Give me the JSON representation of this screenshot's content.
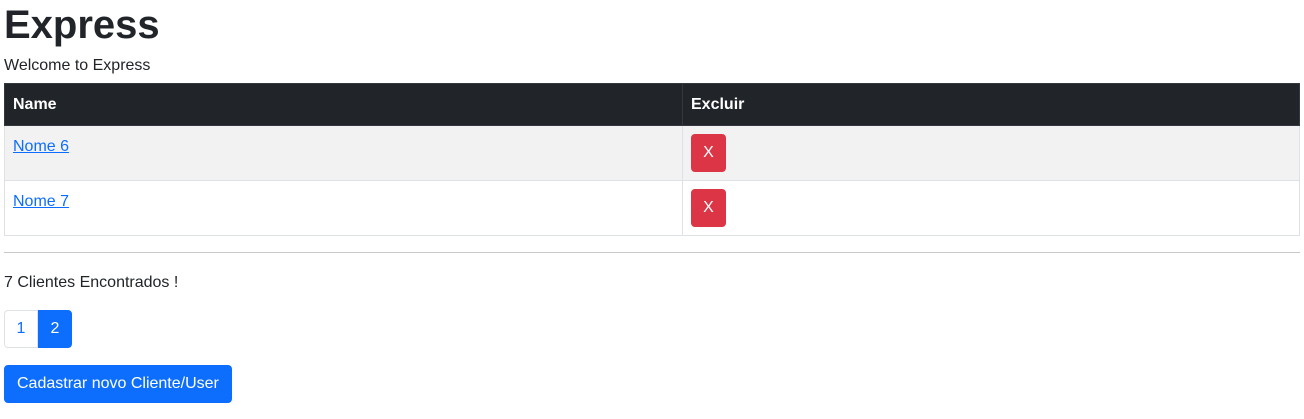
{
  "header": {
    "title": "Express",
    "welcome": "Welcome to Express"
  },
  "table": {
    "columns": [
      "Name",
      "Excluir"
    ],
    "rows": [
      {
        "name": "Nome 6",
        "delete_label": "X"
      },
      {
        "name": "Nome 7",
        "delete_label": "X"
      }
    ]
  },
  "summary": {
    "count_text": "7 Clientes Encontrados !"
  },
  "pagination": {
    "pages": [
      "1",
      "2"
    ],
    "active_page": "2"
  },
  "actions": {
    "create_label": "Cadastrar novo Cliente/User"
  },
  "colors": {
    "header_bg": "#212529",
    "link": "#0d6efd",
    "danger": "#dc3545",
    "primary": "#0d6efd"
  }
}
